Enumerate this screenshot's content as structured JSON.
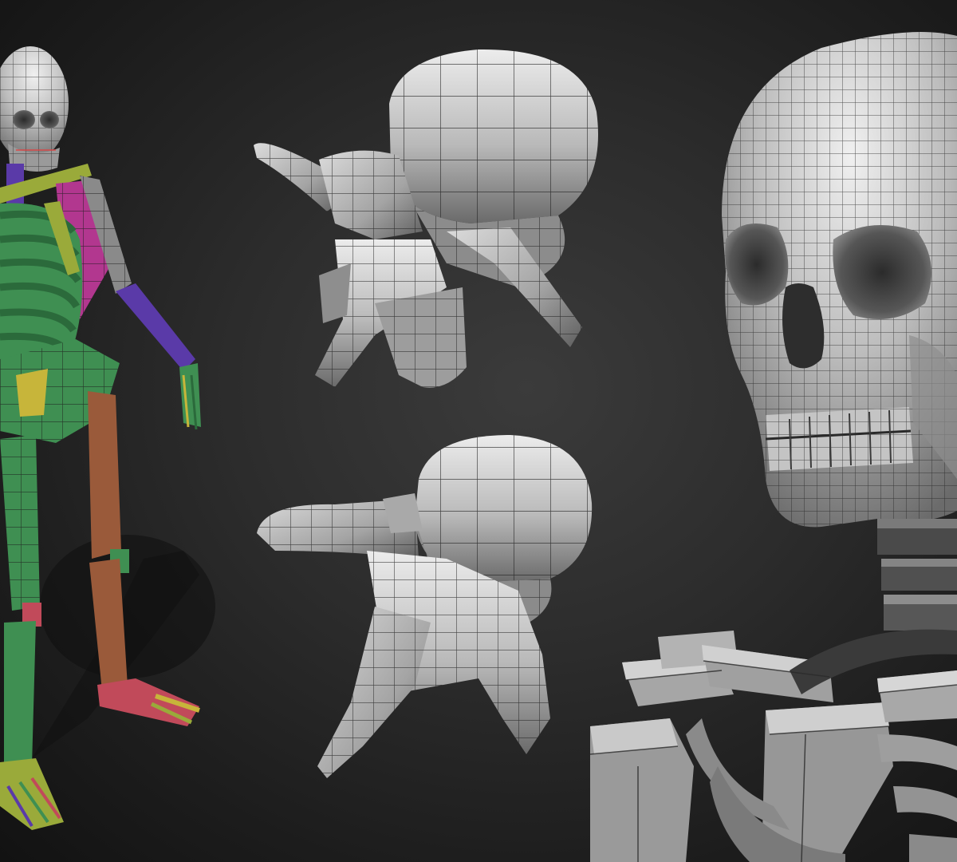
{
  "scene": {
    "subject": "",
    "colors": {
      "background_center": "#3b3b3b",
      "background_edge": "#121212",
      "bone_light": "#e2e2e2",
      "bone_mid": "#a9a9a9",
      "bone_dark": "#5a5a5a",
      "wire": "#1e1e1e",
      "polygroup_green": "#3f8f52",
      "polygroup_magenta": "#b2378f",
      "polygroup_purple": "#5a3aa8",
      "polygroup_brown": "#9a5a3a",
      "polygroup_olive": "#9aaa3a",
      "polygroup_yellow": "#c7b53a",
      "polygroup_red": "#c14a5a"
    }
  }
}
